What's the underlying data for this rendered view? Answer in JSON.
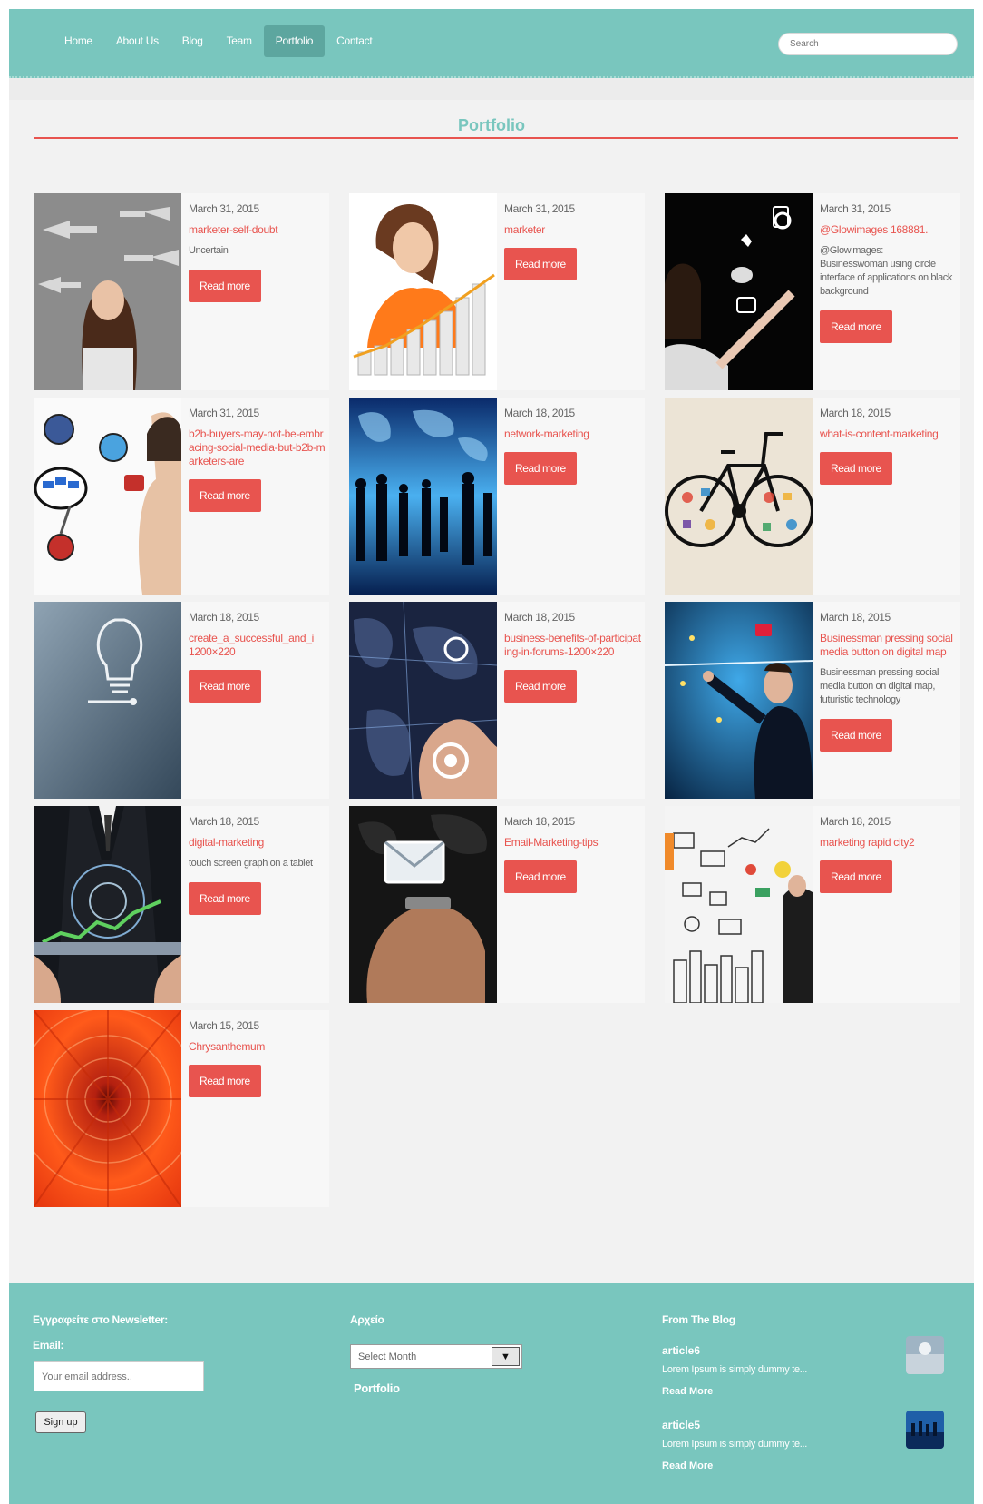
{
  "nav": {
    "items": [
      {
        "label": "Home",
        "name": "nav-home"
      },
      {
        "label": "About Us",
        "name": "nav-about-us"
      },
      {
        "label": "Blog",
        "name": "nav-blog"
      },
      {
        "label": "Team",
        "name": "nav-team"
      },
      {
        "label": "Portfolio",
        "name": "nav-portfolio",
        "active": true
      },
      {
        "label": "Contact",
        "name": "nav-contact"
      }
    ],
    "search_placeholder": "Search"
  },
  "page": {
    "title": "Portfolio"
  },
  "portfolio": {
    "read_more_label": "Read more",
    "items": [
      {
        "date": "March 31, 2015",
        "title": "marketer-self-doubt",
        "excerpt": "Uncertain",
        "image": "woman-thinking-arrows"
      },
      {
        "date": "March 31, 2015",
        "title": "marketer",
        "excerpt": "",
        "image": "businesswoman-rising-chart"
      },
      {
        "date": "March 31, 2015",
        "title": "@Glowimages 168881.",
        "excerpt": "@Glowimages:\nBusinesswoman using circle interface of applications on black background",
        "image": "woman-app-interface"
      },
      {
        "date": "March 31, 2015",
        "title": "b2b-buyers-may-not-be-embracing-social-media-but-b2b-marketers-are",
        "excerpt": "",
        "image": "hand-drawing-social-icons"
      },
      {
        "date": "March 18, 2015",
        "title": "network-marketing",
        "excerpt": "",
        "image": "business-people-world-map"
      },
      {
        "date": "March 18, 2015",
        "title": "what-is-content-marketing",
        "excerpt": "",
        "image": "bicycle-content-icons"
      },
      {
        "date": "March 18, 2015",
        "title": "create_a_successful_and_i\n1200×220",
        "excerpt": "",
        "image": "chalkboard-lightbulb"
      },
      {
        "date": "March 18, 2015",
        "title": "business-benefits-of-participating-in-forums-1200×220",
        "excerpt": "",
        "image": "finger-digital-map"
      },
      {
        "date": "March 18, 2015",
        "title": "Businessman pressing social media button on digital map",
        "excerpt": "Businessman pressing social media button on digital map, futuristic technology",
        "image": "businessman-social-button"
      },
      {
        "date": "March 18, 2015",
        "title": "digital-marketing",
        "excerpt": "touch screen graph on a tablet",
        "image": "tablet-graph"
      },
      {
        "date": "March 18, 2015",
        "title": "Email-Marketing-tips",
        "excerpt": "",
        "image": "hands-phone-email"
      },
      {
        "date": "March 18, 2015",
        "title": "marketing rapid city2",
        "excerpt": "",
        "image": "marketing-sketch-city"
      },
      {
        "date": "March 15, 2015",
        "title": "Chrysanthemum",
        "excerpt": "",
        "image": "orange-chrysanthemum"
      }
    ]
  },
  "footer": {
    "newsletter": {
      "heading": "Εγγραφείτε στο Newsletter:",
      "email_label": "Email:",
      "email_placeholder": "Your email address..",
      "signup_label": "Sign up"
    },
    "archive": {
      "heading": "Αρχείο",
      "select_value": "Select Month",
      "category_link": "Portfolio"
    },
    "blog": {
      "heading": "From The Blog",
      "posts": [
        {
          "title": "article6",
          "text": "Lorem Ipsum is simply dummy te...",
          "more": "Read More"
        },
        {
          "title": "article5",
          "text": "Lorem Ipsum is simply dummy te...",
          "more": "Read More"
        }
      ]
    }
  },
  "colors": {
    "accent": "#79c6be",
    "brand_red": "#e8544f",
    "background": "#f2f2f2"
  }
}
